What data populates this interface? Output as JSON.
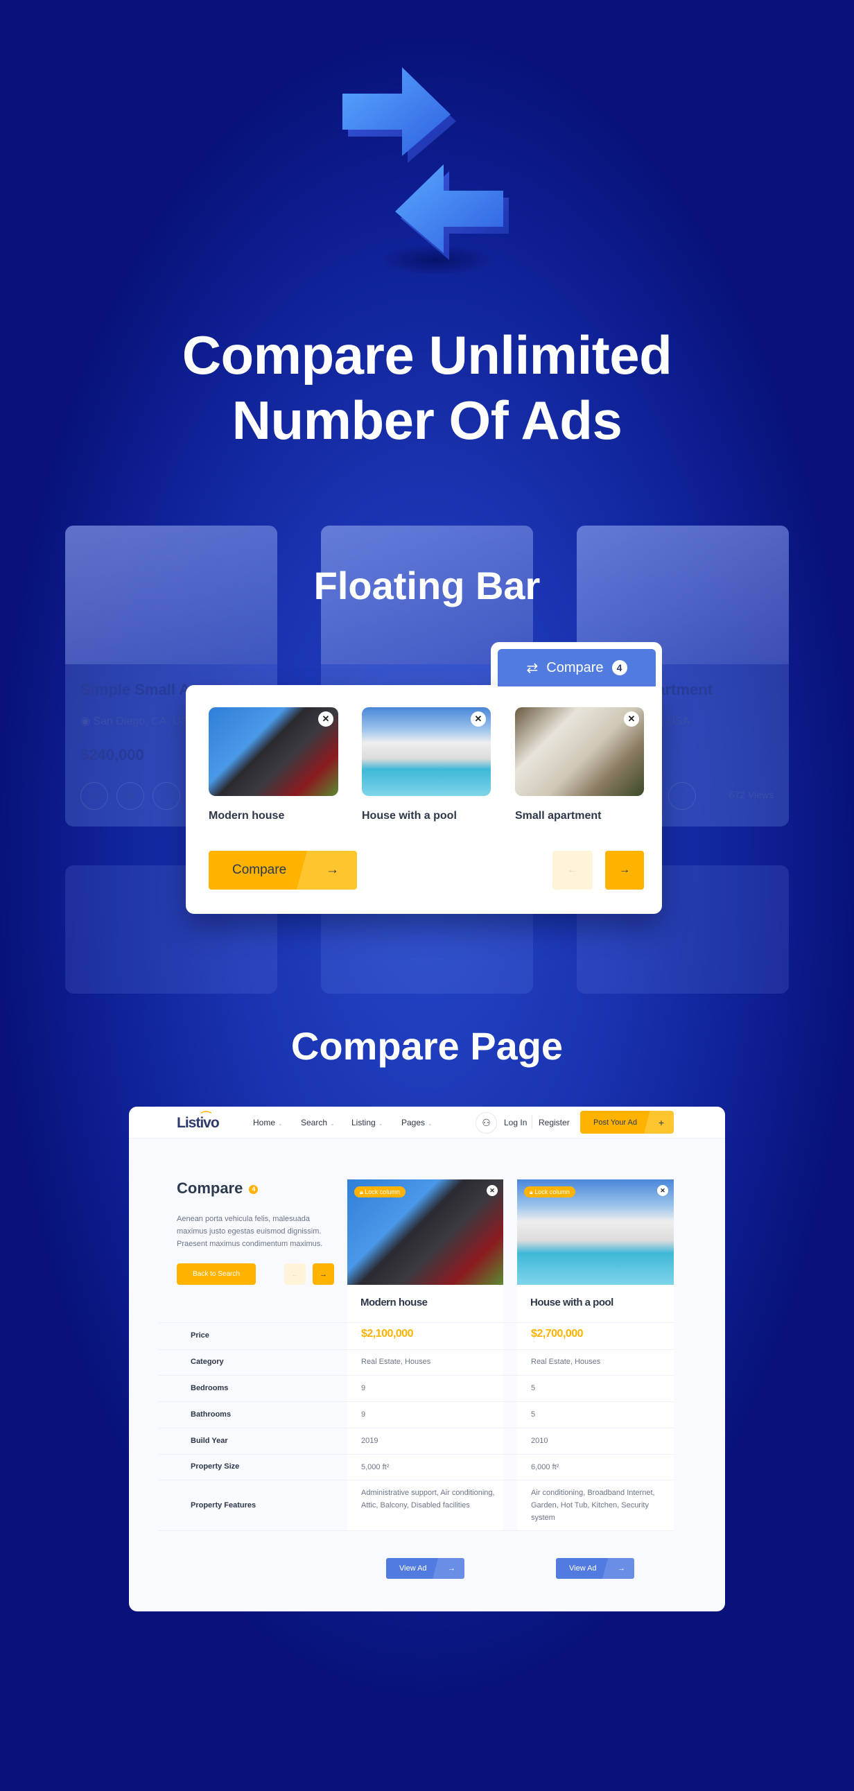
{
  "hero": {
    "title_line1": "Compare Unlimited",
    "title_line2": "Number Of Ads",
    "icon": "compare-arrows-icon"
  },
  "background_cards": [
    {
      "title": "Simple Small Apartment",
      "location": "San Diego, CA, USA",
      "price": "$240,000"
    },
    {
      "title": "",
      "location": "",
      "price": ""
    },
    {
      "title": "Small Apartment",
      "location": "Chicago, IL, USA",
      "views": "672 Views"
    }
  ],
  "floating_bar": {
    "section_title": "Floating Bar",
    "tab_label": "Compare",
    "tab_count": "4",
    "items": [
      {
        "title": "Modern house"
      },
      {
        "title": "House with a pool"
      },
      {
        "title": "Small apartment"
      }
    ],
    "compare_button": "Compare"
  },
  "compare_page": {
    "section_title": "Compare Page",
    "header": {
      "logo": "Listivo",
      "nav": [
        "Home",
        "Search",
        "Listing",
        "Pages"
      ],
      "login": "Log In",
      "register": "Register",
      "post_ad": "Post Your Ad"
    },
    "title": "Compare",
    "count": "4",
    "description": "Aenean porta vehicula felis, malesuada maximus justo egestas euismod dignissim. Praesent maximus condimentum maximus.",
    "back_button": "Back to Search",
    "lock_label": "Lock column",
    "columns": [
      {
        "title": "Modern house",
        "price": "$2,100,000",
        "category": "Real Estate, Houses",
        "bedrooms": "9",
        "bathrooms": "9",
        "build_year": "2019",
        "size": "5,000 ft²",
        "features": "Administrative support, Air conditioning, Attic, Balcony, Disabled facilities",
        "view": "View Ad"
      },
      {
        "title": "House with a pool",
        "price": "$2,700,000",
        "category": "Real Estate, Houses",
        "bedrooms": "5",
        "bathrooms": "5",
        "build_year": "2010",
        "size": "6,000 ft²",
        "features": "Air conditioning, Broadband Internet, Garden, Hot Tub, Kitchen, Security system",
        "view": "View Ad"
      }
    ],
    "row_labels": {
      "price": "Price",
      "category": "Category",
      "bedrooms": "Bedrooms",
      "bathrooms": "Bathrooms",
      "build_year": "Build Year",
      "size": "Property Size",
      "features": "Property Features"
    }
  },
  "colors": {
    "accent": "#ffb300",
    "primary": "#527be0",
    "background": "#1a33b0",
    "text": "#2d3748"
  }
}
